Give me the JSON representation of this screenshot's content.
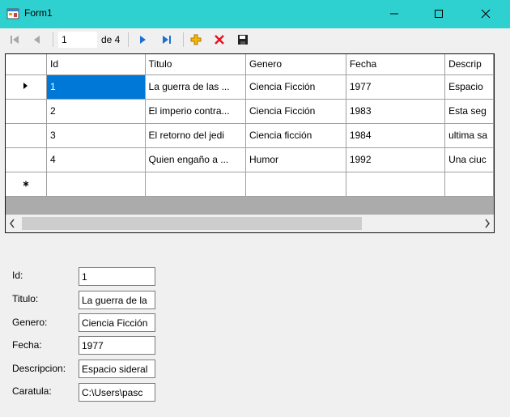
{
  "window": {
    "title": "Form1"
  },
  "navigator": {
    "position": "1",
    "count_label": "de 4"
  },
  "grid": {
    "columns": [
      "Id",
      "Titulo",
      "Genero",
      "Fecha",
      "Descrip"
    ],
    "rows": [
      [
        "1",
        "La guerra de las ...",
        "Ciencia Ficción",
        "1977",
        "Espacio"
      ],
      [
        "2",
        "El imperio contra...",
        "Ciencia Ficción",
        "1983",
        "Esta seg"
      ],
      [
        "3",
        "El retorno del jedi",
        "Ciencia ficción",
        "1984",
        "ultima sa"
      ],
      [
        "4",
        "Quien engaño a ...",
        "Humor",
        "1992",
        "Una ciuc"
      ]
    ]
  },
  "form": {
    "id_label": "Id:",
    "id_value": "1",
    "titulo_label": "Titulo:",
    "titulo_value": "La guerra de la",
    "genero_label": "Genero:",
    "genero_value": "Ciencia Ficción",
    "fecha_label": "Fecha:",
    "fecha_value": "1977",
    "descripcion_label": "Descripcion:",
    "descripcion_value": "Espacio sideral",
    "caratula_label": "Caratula:",
    "caratula_value": "C:\\Users\\pasc"
  },
  "colors": {
    "titlebar": "#2ed0d0",
    "selection": "#0078d7",
    "nav_arrow": "#1f6fd1",
    "add_icon": "#e8a000",
    "delete_icon": "#e81123"
  }
}
